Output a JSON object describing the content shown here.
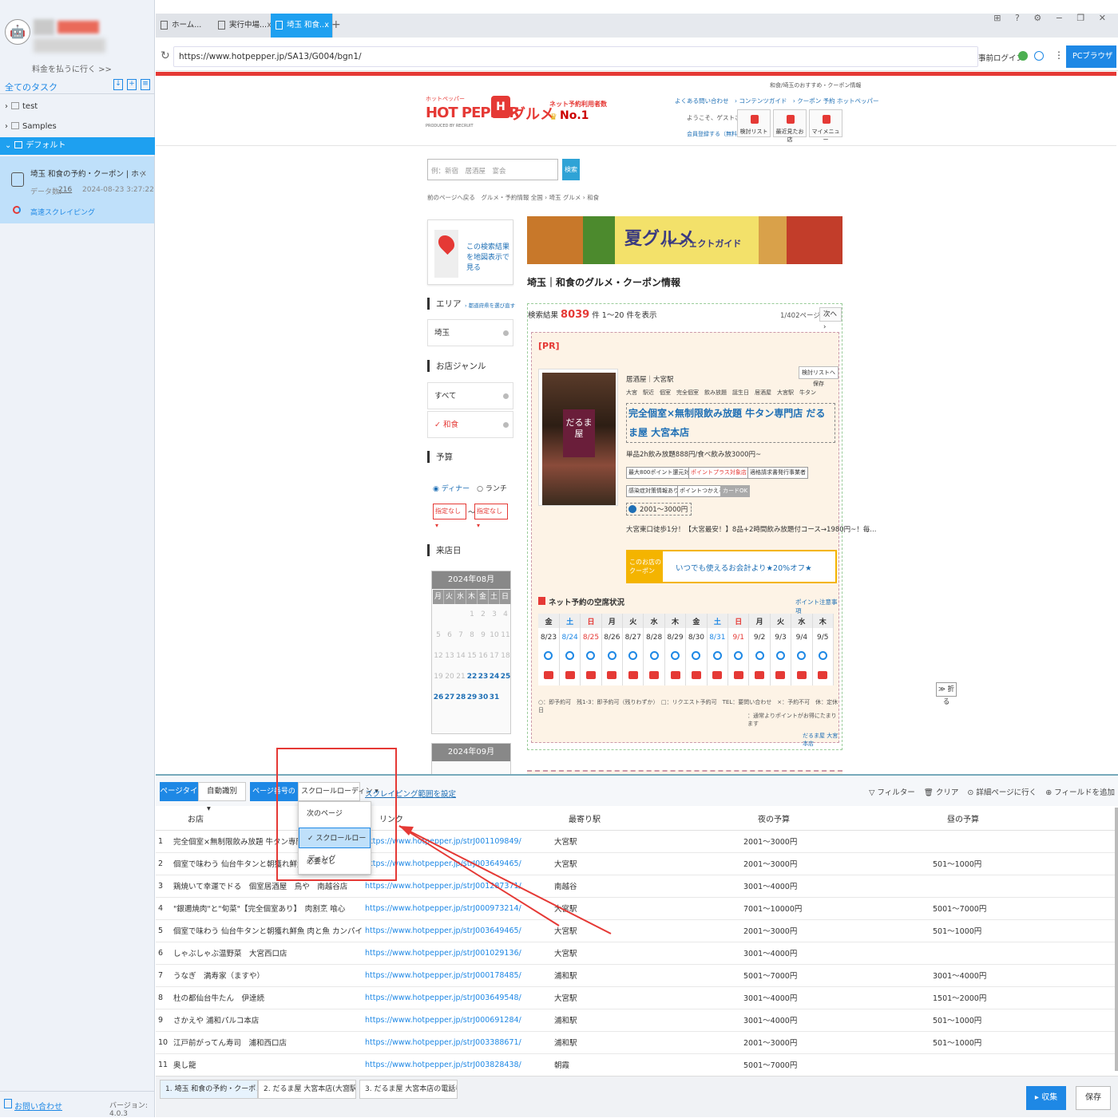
{
  "sidebar": {
    "pay_link": "料金を払うに行く >>",
    "all_tasks": "全てのタスク",
    "tree": [
      "test",
      "Samples",
      "デフォルト"
    ],
    "task": {
      "name": "埼玉 和食の予約・クーポン | ホットペッパー",
      "close": "x",
      "data_label": "データ数:",
      "data_count": "216",
      "date": "2024-08-23 3:27:22",
      "mode": "高速スクレイピング"
    },
    "contact": "お問い合わせ",
    "version": "バージョン: 4.0.3"
  },
  "browser": {
    "tabs": [
      {
        "label": "ホーム...",
        "close": ""
      },
      {
        "label": "実行中場...",
        "close": "x"
      },
      {
        "label": "埼玉 和食...",
        "close": "x"
      }
    ],
    "new_tab": "+",
    "window_controls": "⊞ ? ⚙ − ❐ ✕",
    "url": "https://www.hotpepper.jp/SA13/G004/bgn1/",
    "prelogin": "事前ログイン",
    "pc_browser": "PCブラウザ ▾"
  },
  "page": {
    "top_right": "和食/埼玉のおすすめ・クーポン情報",
    "kana": "ホットペッパー",
    "logo": "HOT PEPPER",
    "logo_h": "H",
    "gourmet": "グルメ",
    "recruit": "PRODUCED BY RECRUIT",
    "net_reserve": "ネット予約利用者数",
    "no1": "No.1",
    "links": "よくある問い合わせ　› コンテンツガイド　› クーポン 予約 ホットペッパー",
    "welcome": "ようこそ、ゲストさん",
    "register": "会員登録する（無料）",
    "header_buttons": [
      "検討リスト",
      "最近見たお店",
      "マイメニュー"
    ],
    "search_placeholder": "例：新宿　居酒屋　宴会",
    "search_button": "検索",
    "breadcrumb": "前のページへ戻る　グルメ・予約情報 全国 › 埼玉 グルメ › 和食",
    "map_text": "この検索結果を地図表示で見る",
    "area_heading": "エリア",
    "area_sub": "› 都道府県を選び直す",
    "area_value": "埼玉",
    "genre_heading": "お店ジャンル",
    "genre_all": "すべて",
    "genre_selected": "✓ 和食",
    "budget_heading": "予算",
    "budget_dinner": "◉ ディナー",
    "budget_lunch": "○ ランチ",
    "budget_from": "指定なし ▾",
    "budget_to": "指定なし ▾",
    "budget_tilde": "〜",
    "date_heading": "来店日",
    "calendar1": {
      "title": "2024年08月",
      "weekdays": [
        "月",
        "火",
        "水",
        "木",
        "金",
        "土",
        "日"
      ],
      "days": [
        "",
        "",
        "",
        "1",
        "2",
        "3",
        "4",
        "5",
        "6",
        "7",
        "8",
        "9",
        "10",
        "11",
        "12",
        "13",
        "14",
        "15",
        "16",
        "17",
        "18",
        "19",
        "20",
        "21",
        "22",
        "23",
        "24",
        "25",
        "26",
        "27",
        "28",
        "29",
        "30",
        "31",
        ""
      ]
    },
    "calendar2_title": "2024年09月",
    "banner_title": "夏グルメ",
    "banner_sub": "パーフェクトガイド",
    "title": "埼玉｜和食のグルメ・クーポン情報",
    "result_prefix": "検索結果",
    "result_count": "8039",
    "result_suffix": "件 1〜20 件を表示",
    "pages": "1/402ページ",
    "next": "次へ ›",
    "pr": "[PR]",
    "shop_logo_text": "だるま屋",
    "save_to_list": "検討リストへ保存",
    "genre_station": "居酒屋｜大宮駅",
    "tags": "大宮　駅近　個室　完全個室　飲み放題　誕生日　居酒屋　大宮駅　牛タン",
    "shop_name": "完全個室×無制限飲み放題 牛タン専門店 だるま屋 大宮本店",
    "drink_info": "単品2h飲み放題888円/食べ飲み放3000円~",
    "badges": [
      "最大800ポイント還元対象店",
      "ポイントプラス対象店",
      "適格請求書発行事業者",
      "感染症対策情報あり",
      "ポイントつかえる",
      "カードOK"
    ],
    "price": "2001～3000円",
    "access": "大宮東口徒歩1分！【大宮最安！】8品+2時間飲み放題付コース→1980円~！毎...",
    "coupon_tag": "このお店のクーポン",
    "coupon": "いつでも使えるお会計より★20%オフ★",
    "availability": "ネット予約の空席状況",
    "point_note": "ポイント注意事項",
    "av_days": [
      "金",
      "土",
      "日",
      "月",
      "火",
      "水",
      "木",
      "金",
      "土",
      "日",
      "月",
      "火",
      "水",
      "木"
    ],
    "av_dates": [
      "8/23",
      "8/24",
      "8/25",
      "8/26",
      "8/27",
      "8/28",
      "8/29",
      "8/30",
      "8/31",
      "9/1",
      "9/2",
      "9/3",
      "9/4",
      "9/5"
    ],
    "legend": "○：即予約可　残1-3：即予約可（残りわずか）　□：リクエスト予約可　TEL：要問い合わせ　×：予約不可　休：定休日",
    "legend2": "：通常よりポイントがお得にたまります",
    "footer_name": "だるま屋 大宮本店",
    "fold": "≫ 折る"
  },
  "toolbar": {
    "page_type_label": "ページタイプ",
    "page_type_value": "自動識別　▾",
    "paging_label": "ページ番号の設定",
    "paging_value": "スクロールローディン ▾",
    "scrape_range": "スクレイピング範囲を設定",
    "filter": "▽ フィルター",
    "clear": "🗑 クリア",
    "go_detail": "⊙ 詳細ページに行く",
    "add_field": "⊕ フィールドを追加"
  },
  "dropdown": {
    "options": [
      "次のページ",
      "✓ スクロールローディング",
      "必要なし"
    ],
    "selected": 1
  },
  "grid": {
    "headers": [
      "お店",
      "リンク",
      "最寄り駅",
      "夜の予算",
      "昼の予算"
    ],
    "rows": [
      [
        "1",
        "完全個室×無制限飲み放題 牛タン専門店 だるま屋 大宮本店",
        "https://www.hotpepper.jp/strJ001109849/",
        "大宮駅",
        "2001～3000円",
        ""
      ],
      [
        "2",
        "個室で味わう 仙台牛タンと朝獲れ鮮魚 肉と魚 カンパイ酒場大宮東口店",
        "https://www.hotpepper.jp/strJ003649465/",
        "大宮駅",
        "2001～3000円",
        "501～1000円"
      ],
      [
        "3",
        "鶏焼いて幸運でドる　個室居酒屋　鳥や　南越谷店",
        "https://www.hotpepper.jp/strJ001287371/",
        "南越谷",
        "3001～4000円",
        ""
      ],
      [
        "4",
        "\"銀邇焼肉\"と\"旬菜\"【完全個室あり】　肉割烹 喰心",
        "https://www.hotpepper.jp/strJ000973214/",
        "大宮駅",
        "7001～10000円",
        "5001～7000円"
      ],
      [
        "5",
        "個室で味わう 仙台牛タンと朝獲れ鮮魚 肉と魚 カンパイ酒場大宮東口店",
        "https://www.hotpepper.jp/strJ003649465/",
        "大宮駅",
        "2001～3000円",
        "501～1000円"
      ],
      [
        "6",
        "しゃぶしゃぶ温野菜　大宮西口店",
        "https://www.hotpepper.jp/strJ001029136/",
        "大宮駅",
        "3001～4000円",
        ""
      ],
      [
        "7",
        "うなぎ　満寿家（ますや）",
        "https://www.hotpepper.jp/strJ000178485/",
        "浦和駅",
        "5001～7000円",
        "3001～4000円"
      ],
      [
        "8",
        "杜の都仙台牛たん　伊達続",
        "https://www.hotpepper.jp/strJ003649548/",
        "大宮駅",
        "3001～4000円",
        "1501～2000円"
      ],
      [
        "9",
        "さかえや 浦和パルコ本店",
        "https://www.hotpepper.jp/strJ000691284/",
        "浦和駅",
        "3001～4000円",
        "501～1000円"
      ],
      [
        "10",
        "江戸前がってん寿司　浦和西口店",
        "https://www.hotpepper.jp/strJ003388671/",
        "浦和駅",
        "2001～3000円",
        "501～1000円"
      ],
      [
        "11",
        "奥し龍",
        "https://www.hotpepper.jp/strJ003828438/",
        "朝霞",
        "5001～7000円",
        ""
      ]
    ]
  },
  "bottom_tabs": [
    "1. 埼玉 和食の予約・クーポン | ホ...",
    "2. だるま屋 大宮本店(大宮駅/居酒...",
    "3. だるま屋 大宮本店の電話番号|..."
  ],
  "collect_button": "▸ 収集",
  "save_button": "保存",
  "colors": {
    "accent": "#1e88e5",
    "hotpepper_red": "#e53935",
    "annotation_red": "#e53935"
  }
}
